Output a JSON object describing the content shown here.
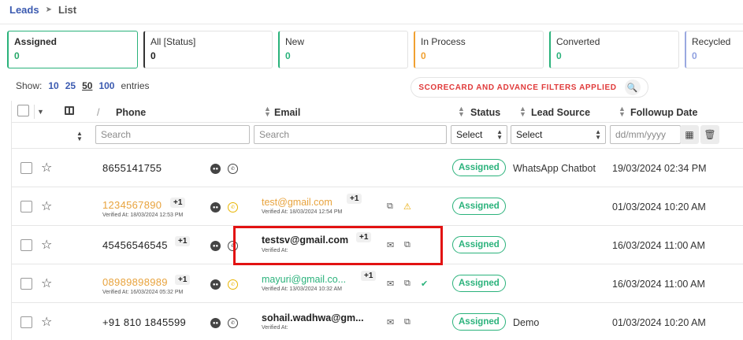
{
  "breadcrumb": {
    "root": "Leads",
    "separator": "➤",
    "current": "List"
  },
  "cards": [
    {
      "label": "Assigned",
      "count": "0"
    },
    {
      "label": "All [Status]",
      "count": "0"
    },
    {
      "label": "New",
      "count": "0"
    },
    {
      "label": "In Process",
      "count": "0"
    },
    {
      "label": "Converted",
      "count": "0"
    },
    {
      "label": "Recycled",
      "count": "0"
    }
  ],
  "show": {
    "prefix": "Show:",
    "options": [
      "10",
      "25",
      "50",
      "100"
    ],
    "selected": "50",
    "suffix": "entries"
  },
  "filters_pill": {
    "text": "SCORECARD AND ADVANCE FILTERS APPLIED",
    "icon": "search-icon"
  },
  "headers": {
    "phone": "Phone",
    "email": "Email",
    "status": "Status",
    "lead_source": "Lead Source",
    "followup_date": "Followup Date"
  },
  "filters": {
    "phone_placeholder": "Search",
    "email_placeholder": "Search",
    "status_select": "Select",
    "source_select": "Select",
    "date_placeholder": "dd/mm/yyyy"
  },
  "rows": [
    {
      "phone": "8655141755",
      "phone_plus": "",
      "phone_verified": "",
      "email": "",
      "email_plus": "",
      "email_verified": "",
      "status": "Assigned",
      "source": "WhatsApp Chatbot",
      "followup": "19/03/2024 02:34 PM"
    },
    {
      "phone": "1234567890",
      "phone_plus": "+1",
      "phone_verified": "Verified At: 18/03/2024 12:53 PM",
      "email": "test@gmail.com",
      "email_plus": "+1",
      "email_verified": "Verified At: 18/03/2024 12:54 PM",
      "status": "Assigned",
      "source": "",
      "followup": "01/03/2024 10:20 AM"
    },
    {
      "phone": "45456546545",
      "phone_plus": "+1",
      "phone_verified": "",
      "email": "testsv@gmail.com",
      "email_plus": "+1",
      "email_verified": "Verified At:",
      "status": "Assigned",
      "source": "",
      "followup": "16/03/2024 11:00 AM"
    },
    {
      "phone": "08989898989",
      "phone_plus": "+1",
      "phone_verified": "Verified At: 16/03/2024 05:32 PM",
      "email": "mayuri@gmail.co...",
      "email_plus": "+1",
      "email_verified": "Verified At: 13/03/2024 10:32 AM",
      "status": "Assigned",
      "source": "",
      "followup": "16/03/2024 11:00 AM"
    },
    {
      "phone": "+91 810 1845599",
      "phone_plus": "",
      "phone_verified": "",
      "email": "sohail.wadhwa@gm...",
      "email_plus": "",
      "email_verified": "Verified At:",
      "status": "Assigned",
      "source": "Demo",
      "followup": "01/03/2024 10:20 AM"
    }
  ],
  "colors": {
    "accent_blue": "#3b5ab0",
    "green": "#2ab27b",
    "orange": "#f0a030",
    "highlight_red": "#e21212"
  }
}
